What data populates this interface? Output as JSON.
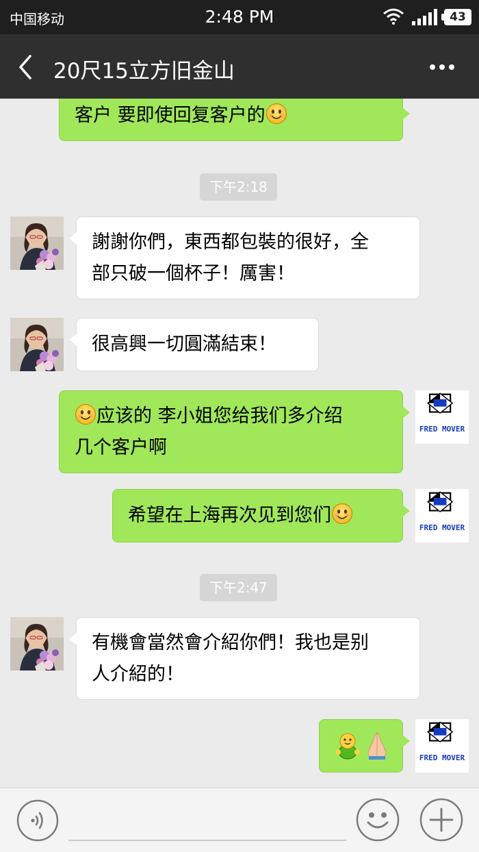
{
  "status_bar": {
    "carrier": "中国移动",
    "time": "2:48 PM",
    "battery": "43"
  },
  "header": {
    "title": "20尺15立方旧金山"
  },
  "messages": {
    "m0": "客户 要即使回复客户的",
    "t1": "下午2:18",
    "m1_l1": "謝謝你們，東西都包裝的很好，全",
    "m1_l2": "部只破一個杯子！厲害！",
    "m2": "很高興一切圓滿結束！",
    "m3_l1": "应该的 李小姐您给我们多介绍",
    "m3_l2": "几个客户啊",
    "m4": "希望在上海再次见到您们",
    "t2": "下午2:47",
    "m5_l1": "有機會當然會介紹你們！我也是别",
    "m5_l2": "人介紹的！"
  },
  "avatars": {
    "logo_text": "FRED MOVER",
    "logo_mark": "ZZ"
  },
  "input": {
    "placeholder": ""
  },
  "colors": {
    "sent_bubble": "#a0e75a",
    "received_bubble": "#ffffff",
    "header": "#2f2f2f",
    "background": "#ebebeb"
  },
  "icons": [
    "back-arrow-icon",
    "more-dots-icon",
    "voice-icon",
    "emoji-icon",
    "plus-icon",
    "smile-emoji-icon",
    "thumbs-up-figure-emoji-icon",
    "praying-hands-emoji-icon",
    "wifi-icon",
    "signal-icon"
  ]
}
